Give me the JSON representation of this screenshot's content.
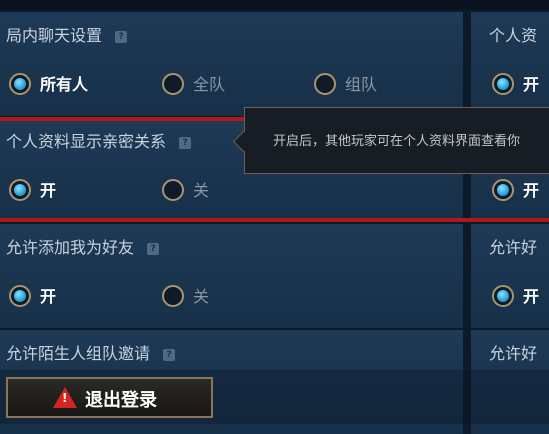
{
  "sections": [
    {
      "title": "局内聊天设置",
      "options": [
        "所有人",
        "全队",
        "组队"
      ],
      "selected": 0
    },
    {
      "title": "个人资料显示亲密关系",
      "options": [
        "开",
        "关"
      ],
      "selected": 0
    },
    {
      "title": "允许添加我为好友",
      "options": [
        "开",
        "关"
      ],
      "selected": 0
    },
    {
      "title": "允许陌生人组队邀请",
      "options": [],
      "selected": -1
    }
  ],
  "right_column": {
    "titles": [
      "个人资",
      "",
      "允许好",
      "允许好"
    ],
    "option_label": "开"
  },
  "tooltip": {
    "text": "开启后，其他玩家可在个人资料界面查看你"
  },
  "logout_button": {
    "label": "退出登录",
    "icon": "warning-icon"
  },
  "help_icon": {
    "glyph": "?"
  },
  "colors": {
    "highlight_line": "#b11818",
    "radio_selected": "#2fa7e0",
    "panel_bg": "#1e3a56"
  }
}
